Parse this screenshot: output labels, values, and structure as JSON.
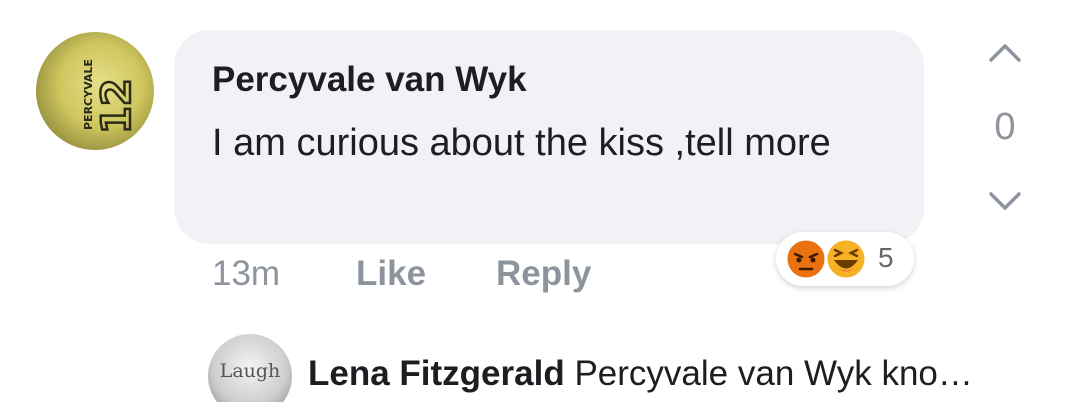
{
  "comment": {
    "author": "Percyvale van Wyk",
    "text": "I am curious about the kiss ,tell more",
    "time": "13m",
    "like_label": "Like",
    "reply_label": "Reply",
    "reactions": {
      "icons": [
        "angry-icon",
        "haha-icon"
      ],
      "count": "5"
    },
    "avatar": {
      "jersey_text": "PERCYVALE",
      "jersey_number": "12"
    }
  },
  "votes": {
    "count": "0",
    "up_icon": "chevron-up-icon",
    "down_icon": "chevron-down-icon"
  },
  "reply_preview": {
    "author": "Lena Fitzgerald",
    "text": "Percyvale van Wyk kno…",
    "avatar_text": "Laugh"
  },
  "colors": {
    "bubble": "#f0f2f5",
    "text": "#1c1e21",
    "muted": "#8d949e",
    "angry": "#e9710f",
    "haha": "#f7b125"
  }
}
